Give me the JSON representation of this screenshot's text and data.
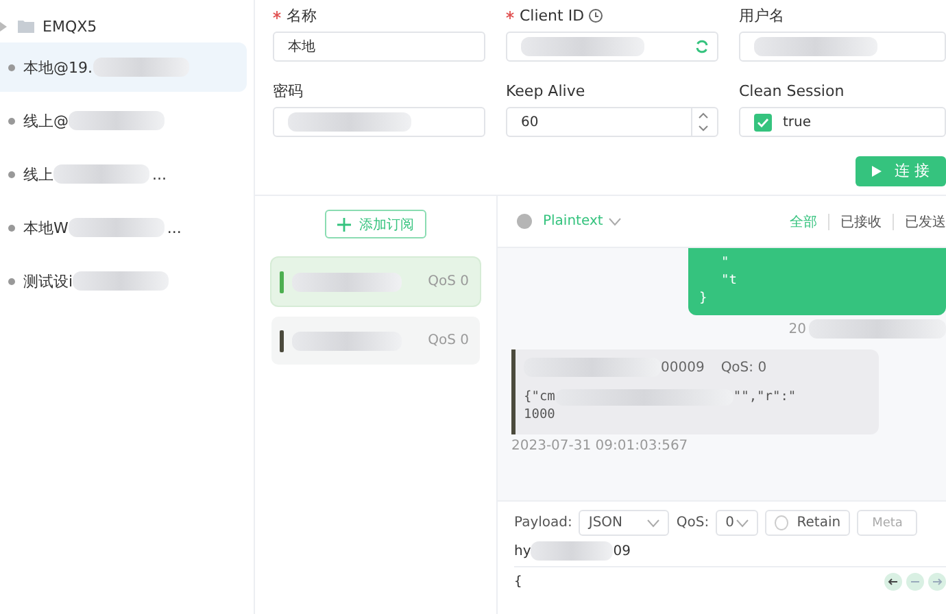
{
  "sidebar": {
    "group": "EMQX5",
    "items": [
      {
        "label": "本地@19.",
        "selected": true
      },
      {
        "label": "线上@",
        "selected": false
      },
      {
        "label": "线上",
        "suffix": "...",
        "selected": false
      },
      {
        "label": "本地W",
        "suffix": "...",
        "selected": false
      },
      {
        "label": "测试设i",
        "selected": false
      }
    ]
  },
  "form": {
    "fields": [
      {
        "kind": "text",
        "label": "名称",
        "required": true,
        "value": "本地"
      },
      {
        "kind": "clientid",
        "label": "Client ID",
        "required": true
      },
      {
        "kind": "text",
        "label": "用户名"
      },
      {
        "kind": "text",
        "label": "密码"
      },
      {
        "kind": "number",
        "label": "Keep Alive",
        "value": "60"
      },
      {
        "kind": "checkbox",
        "label": "Clean Session",
        "value": "true",
        "checked": true
      }
    ],
    "connect_button": "连 接"
  },
  "subscriptions": {
    "add_button": "添加订阅",
    "items": [
      {
        "color": "#4caf50",
        "qos": "QoS 0",
        "selected": true
      },
      {
        "color": "#4b4a3c",
        "qos": "QoS 0",
        "selected": false
      }
    ]
  },
  "messages": {
    "format": "Plaintext",
    "filters": [
      {
        "label": "全部",
        "selected": true
      },
      {
        "label": "已接收",
        "selected": false
      },
      {
        "label": "已发送",
        "selected": false
      }
    ],
    "sent": {
      "lines": [
        "\"",
        "\"t",
        "}"
      ],
      "time": "20"
    },
    "received": {
      "topic_tail": "00009",
      "qos": "QoS: 0",
      "line1_start": "{\"cm",
      "line1_end": "\"\",\"r\":\"",
      "line2": "1000",
      "time": "2023-07-31 09:01:03:567"
    }
  },
  "publish": {
    "payload_label": "Payload:",
    "format": "JSON",
    "qos_label": "QoS:",
    "qos": "0",
    "retain": {
      "label": "Retain",
      "checked": false
    },
    "meta": "Meta",
    "topic_start": "hy",
    "topic_end": "09",
    "editor": "{"
  }
}
